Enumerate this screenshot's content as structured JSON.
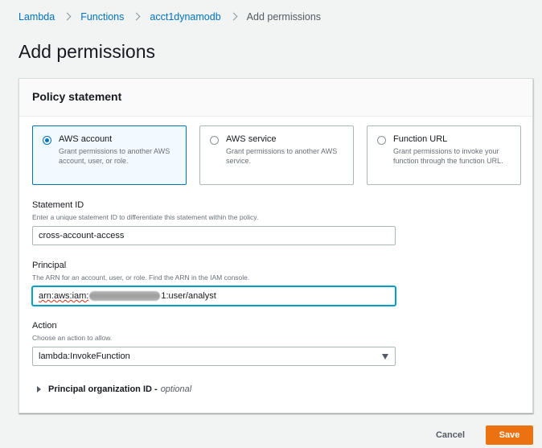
{
  "breadcrumb": {
    "items": [
      "Lambda",
      "Functions",
      "acct1dynamodb"
    ],
    "current": "Add permissions"
  },
  "page": {
    "title": "Add permissions"
  },
  "policy": {
    "title": "Policy statement",
    "tiles": [
      {
        "title": "AWS account",
        "description": "Grant permissions to another AWS account, user, or role.",
        "selected": true
      },
      {
        "title": "AWS service",
        "description": "Grant permissions to another AWS service.",
        "selected": false
      },
      {
        "title": "Function URL",
        "description": "Grant permissions to invoke your function through the function URL.",
        "selected": false
      }
    ],
    "statement_id": {
      "label": "Statement ID",
      "description": "Enter a unique statement ID to differentiate this statement within the policy.",
      "value": "cross-account-access"
    },
    "principal": {
      "label": "Principal",
      "description": "The ARN for an account, user, or role. Find the ARN in the IAM console.",
      "value_prefix": "arn:aws:iam:",
      "value_suffix": "1:user/analyst"
    },
    "action": {
      "label": "Action",
      "description": "Choose an action to allow.",
      "value": "lambda:InvokeFunction"
    },
    "org_id": {
      "label": "Principal organization ID -",
      "optional": "optional"
    }
  },
  "footer": {
    "cancel_label": "Cancel",
    "save_label": "Save"
  },
  "colors": {
    "link": "#0073bb",
    "primary": "#ec7211",
    "focus": "#00a1c9"
  }
}
